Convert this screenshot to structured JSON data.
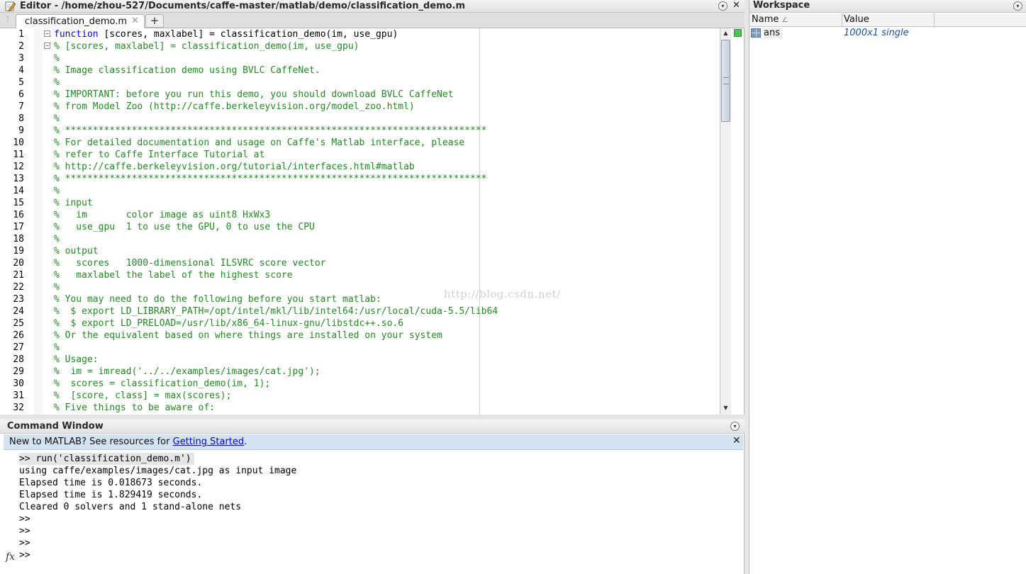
{
  "editor": {
    "title": "Editor - /home/zhou-527/Documents/caffe-master/matlab/demo/classification_demo.m",
    "tab_label": "classification_demo.m",
    "tab_close": "✕",
    "new_tab": "+",
    "minimize_glyph": "▾",
    "close_glyph": "✕",
    "lines": [
      {
        "n": "1",
        "fold": "⊟",
        "segs": [
          {
            "t": "function",
            "c": "kw"
          },
          {
            "t": " [scores, maxlabel] = classification_demo(im, use_gpu)",
            "c": ""
          }
        ]
      },
      {
        "n": "2",
        "fold": "⊟",
        "segs": [
          {
            "t": "% [scores, maxlabel] = classification_demo(im, use_gpu)",
            "c": "cm"
          }
        ]
      },
      {
        "n": "3",
        "segs": [
          {
            "t": "%",
            "c": "cm"
          }
        ]
      },
      {
        "n": "4",
        "segs": [
          {
            "t": "% Image classification demo using BVLC CaffeNet.",
            "c": "cm"
          }
        ]
      },
      {
        "n": "5",
        "segs": [
          {
            "t": "%",
            "c": "cm"
          }
        ]
      },
      {
        "n": "6",
        "segs": [
          {
            "t": "% IMPORTANT: before you run this demo, you should download BVLC CaffeNet",
            "c": "cm"
          }
        ]
      },
      {
        "n": "7",
        "segs": [
          {
            "t": "% from Model Zoo (http://caffe.berkeleyvision.org/model_zoo.html)",
            "c": "cm"
          }
        ]
      },
      {
        "n": "8",
        "segs": [
          {
            "t": "%",
            "c": "cm"
          }
        ]
      },
      {
        "n": "9",
        "segs": [
          {
            "t": "% ****************************************************************************",
            "c": "cm"
          }
        ]
      },
      {
        "n": "10",
        "segs": [
          {
            "t": "% For detailed documentation and usage on Caffe's Matlab interface, please",
            "c": "cm"
          }
        ]
      },
      {
        "n": "11",
        "segs": [
          {
            "t": "% refer to Caffe Interface Tutorial at",
            "c": "cm"
          }
        ]
      },
      {
        "n": "12",
        "segs": [
          {
            "t": "% http://caffe.berkeleyvision.org/tutorial/interfaces.html#matlab",
            "c": "cm"
          }
        ]
      },
      {
        "n": "13",
        "segs": [
          {
            "t": "% ****************************************************************************",
            "c": "cm"
          }
        ]
      },
      {
        "n": "14",
        "segs": [
          {
            "t": "%",
            "c": "cm"
          }
        ]
      },
      {
        "n": "15",
        "segs": [
          {
            "t": "% input",
            "c": "cm"
          }
        ]
      },
      {
        "n": "16",
        "segs": [
          {
            "t": "%   im       color image as uint8 HxWx3",
            "c": "cm"
          }
        ]
      },
      {
        "n": "17",
        "segs": [
          {
            "t": "%   use_gpu  1 to use the GPU, 0 to use the CPU",
            "c": "cm"
          }
        ]
      },
      {
        "n": "18",
        "segs": [
          {
            "t": "%",
            "c": "cm"
          }
        ]
      },
      {
        "n": "19",
        "segs": [
          {
            "t": "% output",
            "c": "cm"
          }
        ]
      },
      {
        "n": "20",
        "segs": [
          {
            "t": "%   scores   1000-dimensional ILSVRC score vector",
            "c": "cm"
          }
        ]
      },
      {
        "n": "21",
        "segs": [
          {
            "t": "%   maxlabel the label of the highest score",
            "c": "cm"
          }
        ]
      },
      {
        "n": "22",
        "segs": [
          {
            "t": "%",
            "c": "cm"
          }
        ]
      },
      {
        "n": "23",
        "segs": [
          {
            "t": "% You may need to do the following before you start matlab:",
            "c": "cm"
          }
        ]
      },
      {
        "n": "24",
        "segs": [
          {
            "t": "%  $ export LD_LIBRARY_PATH=/opt/intel/mkl/lib/intel64:/usr/local/cuda-5.5/lib64",
            "c": "cm"
          }
        ]
      },
      {
        "n": "25",
        "segs": [
          {
            "t": "%  $ export LD_PRELOAD=/usr/lib/x86_64-linux-gnu/libstdc++.so.6",
            "c": "cm"
          }
        ]
      },
      {
        "n": "26",
        "segs": [
          {
            "t": "% Or the equivalent based on where things are installed on your system",
            "c": "cm"
          }
        ]
      },
      {
        "n": "27",
        "segs": [
          {
            "t": "%",
            "c": "cm"
          }
        ]
      },
      {
        "n": "28",
        "segs": [
          {
            "t": "% Usage:",
            "c": "cm"
          }
        ]
      },
      {
        "n": "29",
        "segs": [
          {
            "t": "%  im = imread('../../examples/images/cat.jpg');",
            "c": "cm"
          }
        ]
      },
      {
        "n": "30",
        "segs": [
          {
            "t": "%  scores = classification_demo(im, 1);",
            "c": "cm"
          }
        ]
      },
      {
        "n": "31",
        "segs": [
          {
            "t": "%  [score, class] = max(scores);",
            "c": "cm"
          }
        ]
      },
      {
        "n": "32",
        "segs": [
          {
            "t": "% Five things to be aware of:",
            "c": "cm"
          }
        ]
      }
    ],
    "watermark": "http://blog.csdn.net/"
  },
  "command_window": {
    "title": "Command Window",
    "banner_prefix": "New to MATLAB? See resources for ",
    "banner_link": "Getting Started",
    "banner_suffix": ".",
    "banner_close": "✕",
    "minimize_glyph": "▾",
    "fx": "fx",
    "lines": [
      ">> run('classification_demo.m')",
      "using caffe/examples/images/cat.jpg as input image",
      "Elapsed time is 0.018673 seconds.",
      "Elapsed time is 1.829419 seconds.",
      "Cleared 0 solvers and 1 stand-alone nets",
      ">>",
      ">>",
      ">>",
      ">>"
    ]
  },
  "workspace": {
    "title": "Workspace",
    "minimize_glyph": "▾",
    "columns": {
      "name": "Name",
      "sort_glyph": "∠",
      "value": "Value"
    },
    "variables": [
      {
        "name": "ans",
        "value": "1000x1 single"
      }
    ]
  },
  "colors": {
    "keyword": "#0000ff",
    "comment": "#228b22",
    "banner_bg": "#d4e2f1",
    "link": "#0000ee",
    "status_ok": "#4fc24f"
  },
  "icons": [
    "pencil-icon",
    "minimize-icon",
    "close-icon",
    "fold-icon",
    "fx-icon",
    "variable-icon",
    "sort-icon"
  ]
}
